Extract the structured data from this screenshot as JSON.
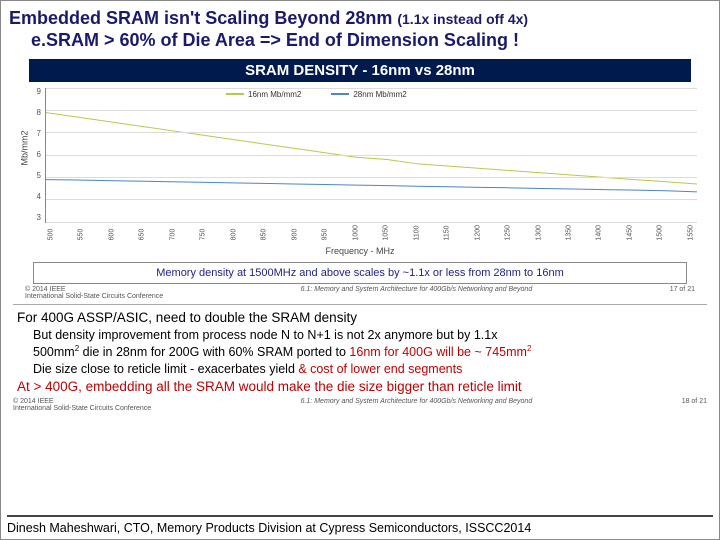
{
  "title": {
    "line1_main": "Embedded SRAM isn't Scaling Beyond 28nm ",
    "line1_sub": "(1.1x instead off 4x)",
    "line2": "e.SRAM > 60% of Die Area => End of Dimension Scaling !"
  },
  "chart_data": {
    "type": "line",
    "title": "SRAM DENSITY - 16nm vs 28nm",
    "xlabel": "Frequency - MHz",
    "ylabel": "Mb/mm2",
    "xlim": [
      500,
      1550
    ],
    "ylim": [
      3,
      9
    ],
    "x": [
      500,
      550,
      600,
      650,
      700,
      750,
      800,
      850,
      900,
      950,
      1000,
      1050,
      1100,
      1150,
      1200,
      1250,
      1300,
      1350,
      1400,
      1450,
      1500,
      1550
    ],
    "series": [
      {
        "name": "16nm Mb/mm2",
        "color": "#b8c94a",
        "values": [
          7.9,
          7.7,
          7.5,
          7.3,
          7.1,
          6.9,
          6.7,
          6.5,
          6.3,
          6.1,
          5.9,
          5.8,
          5.6,
          5.5,
          5.4,
          5.3,
          5.2,
          5.1,
          5.0,
          4.9,
          4.8,
          4.7
        ]
      },
      {
        "name": "28nm Mb/mm2",
        "color": "#4a86c9",
        "values": [
          4.9,
          4.88,
          4.85,
          4.83,
          4.8,
          4.78,
          4.75,
          4.73,
          4.7,
          4.68,
          4.65,
          4.63,
          4.6,
          4.58,
          4.55,
          4.53,
          4.5,
          4.48,
          4.45,
          4.43,
          4.4,
          4.35
        ]
      }
    ],
    "takeaway": "Memory density at 1500MHz and above scales by ~1.1x or less from 28nm to 16nm"
  },
  "conf_footer": {
    "left": "© 2014 IEEE\nInternational Solid-State Circuits Conference",
    "mid": "6.1: Memory and System Architecture for 400Gb/s Networking and Beyond",
    "right_upper": "17 of 21",
    "right_lower": "18 of 21"
  },
  "block2": {
    "header": "For 400G ASSP/ASIC, need to double the SRAM density",
    "row1": "But density improvement from process node N to N+1 is not 2x anymore but by 1.1x",
    "row2_a": "500mm",
    "row2_sup1": "2",
    "row2_b": " die in 28nm for 200G with 60% SRAM ported to ",
    "row2_red": "16nm for 400G will be ~ 745mm",
    "row2_sup2": "2",
    "row3_a": "Die size close to reticle limit - exacerbates yield ",
    "row3_red": " & cost of  lower end segments",
    "row4": "At > 400G, embedding all the SRAM would make the die size bigger than reticle limit"
  },
  "credits": "Dinesh Maheshwari, CTO, Memory Products Division at Cypress Semiconductors, ISSCC2014"
}
